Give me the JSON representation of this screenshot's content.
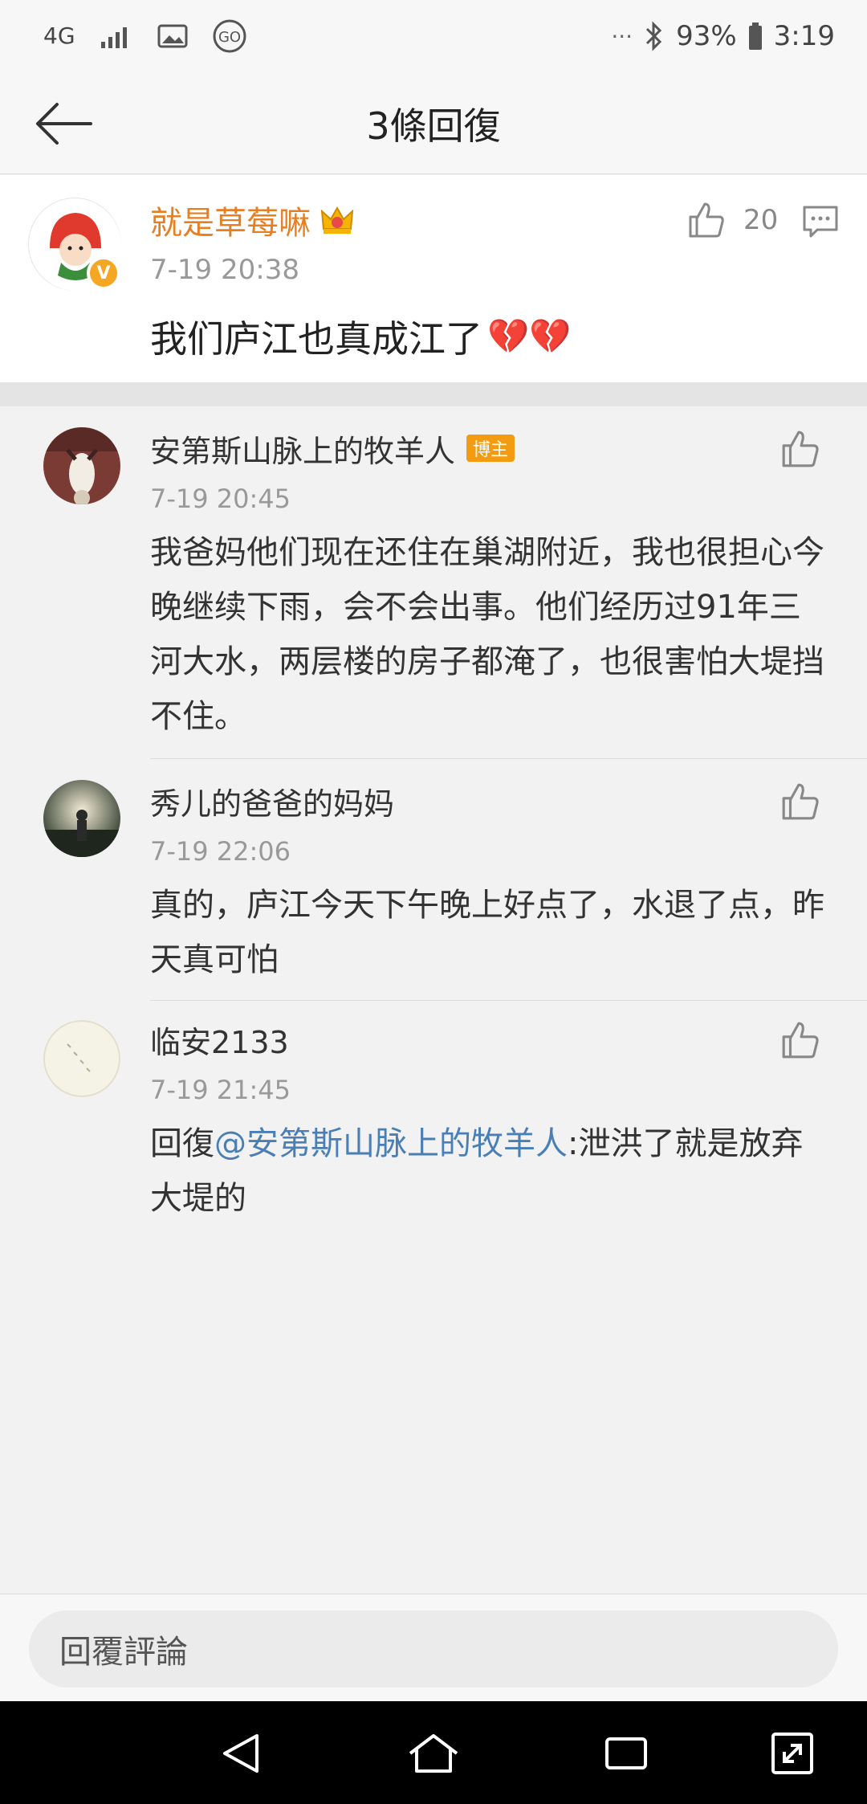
{
  "status_bar": {
    "network": "4G",
    "dots": "···",
    "battery": "93%",
    "time": "3:19"
  },
  "header": {
    "title": "3條回復",
    "back_icon": "arrow-left-icon"
  },
  "main_comment": {
    "user": "就是草莓嘛",
    "time": "7-19 20:38",
    "text": "我们庐江也真成江了",
    "emoji": "💔💔",
    "likes": "20"
  },
  "replies": [
    {
      "user": "安第斯山脉上的牧羊人",
      "badge": "博主",
      "time": "7-19 20:45",
      "text": "我爸妈他们现在还住在巢湖附近，我也很担心今晚继续下雨，会不会出事。他们经历过91年三河大水，两层楼的房子都淹了，也很害怕大堤挡不住。"
    },
    {
      "user": "秀儿的爸爸的妈妈",
      "time": "7-19 22:06",
      "text": "真的，庐江今天下午晚上好点了，水退了点，昨天真可怕"
    },
    {
      "user": "临安2133",
      "time": "7-19 21:45",
      "text_prefix": "回復",
      "mention": "@安第斯山脉上的牧羊人",
      "text_suffix": ":泄洪了就是放弃大堤的"
    }
  ],
  "input": {
    "placeholder": "回覆評論"
  },
  "colors": {
    "accent_name": "#e67e22",
    "mention": "#4a7fb5",
    "badge": "#f39c12",
    "verified": "#f5a623"
  }
}
